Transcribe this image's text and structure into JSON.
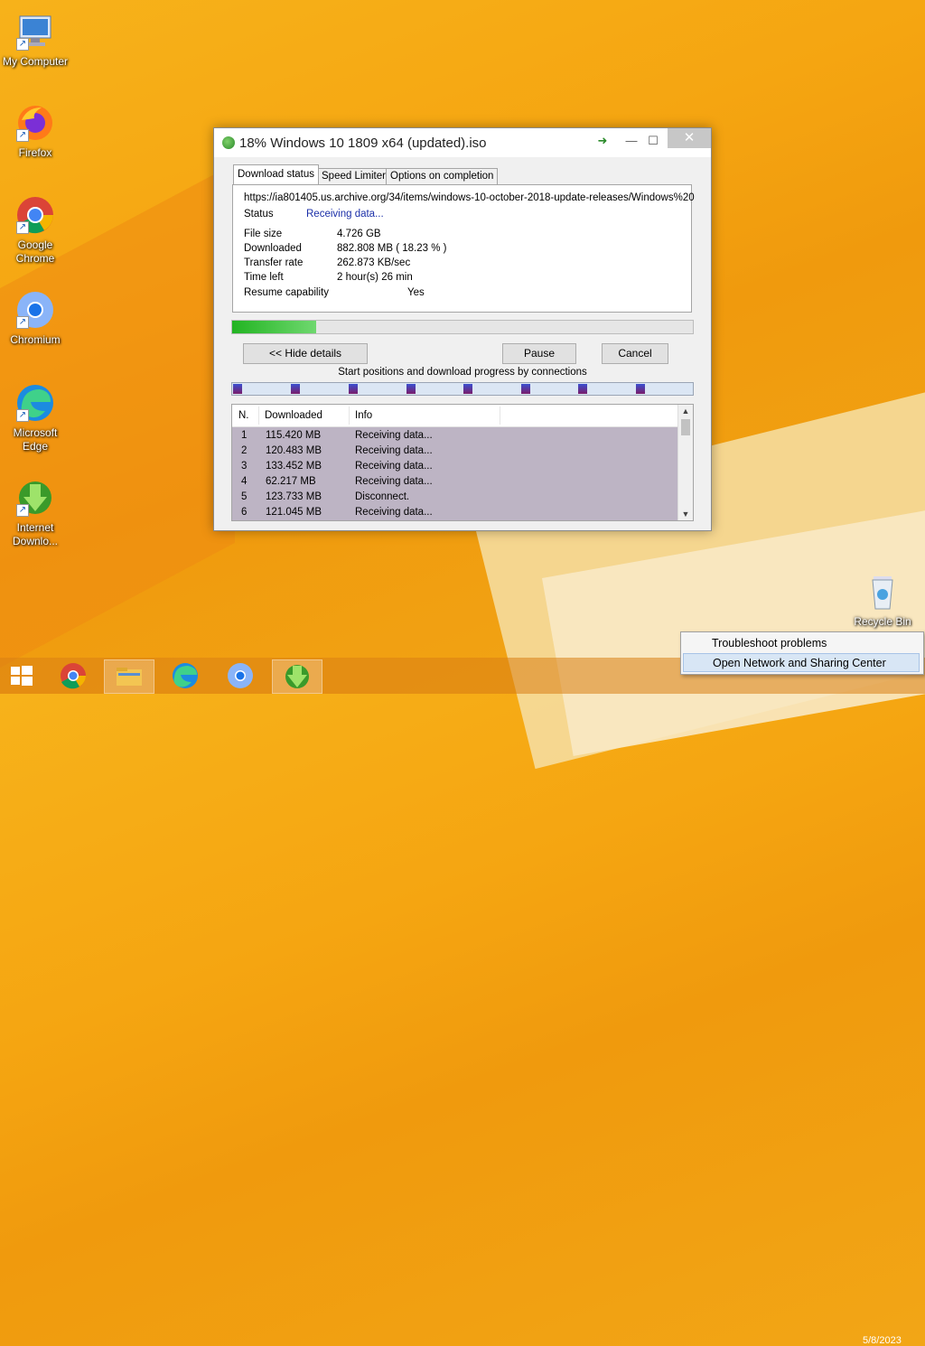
{
  "desktop": {
    "icons": [
      {
        "label": "My Computer"
      },
      {
        "label": "Firefox"
      },
      {
        "label": "Google Chrome"
      },
      {
        "label": "Chromium"
      },
      {
        "label": "Microsoft Edge"
      },
      {
        "label": "Internet Downlo..."
      }
    ],
    "recycle_bin": "Recycle Bin"
  },
  "window": {
    "title": "18% Windows 10 1809 x64 (updated).iso",
    "close_glyph": "✕",
    "minimize_glyph": "—",
    "maximize_glyph": "☐",
    "tabs": [
      "Download status",
      "Speed Limiter",
      "Options on completion"
    ],
    "url": "https://ia801405.us.archive.org/34/items/windows-10-october-2018-update-releases/Windows%20",
    "status_label": "Status",
    "status_value": "Receiving data...",
    "file_size_label": "File size",
    "file_size_value": "4.726  GB",
    "downloaded_label": "Downloaded",
    "downloaded_value": "882.808  MB  ( 18.23 % )",
    "transfer_rate_label": "Transfer rate",
    "transfer_rate_value": "262.873  KB/sec",
    "time_left_label": "Time left",
    "time_left_value": "2 hour(s) 26 min",
    "resume_label": "Resume capability",
    "resume_value": "Yes",
    "progress_percent": 18.23,
    "hide_details_label": "<< Hide details",
    "pause_label": "Pause",
    "cancel_label": "Cancel",
    "connections_caption": "Start positions and download progress by connections",
    "table": {
      "headers": [
        "N.",
        "Downloaded",
        "Info"
      ],
      "rows": [
        {
          "n": "1",
          "downloaded": "115.420  MB",
          "info": "Receiving data..."
        },
        {
          "n": "2",
          "downloaded": "120.483  MB",
          "info": "Receiving data..."
        },
        {
          "n": "3",
          "downloaded": "133.452  MB",
          "info": "Receiving data..."
        },
        {
          "n": "4",
          "downloaded": "62.217  MB",
          "info": "Receiving data..."
        },
        {
          "n": "5",
          "downloaded": "123.733  MB",
          "info": "Disconnect."
        },
        {
          "n": "6",
          "downloaded": "121.045  MB",
          "info": "Receiving data..."
        }
      ]
    }
  },
  "context_menu": {
    "items": [
      "Troubleshoot problems",
      "Open Network and Sharing Center"
    ]
  },
  "clock": {
    "date": "5/8/2023"
  },
  "colors": {
    "accent_progress": "#22b422",
    "status_text": "#1b2fa8"
  }
}
